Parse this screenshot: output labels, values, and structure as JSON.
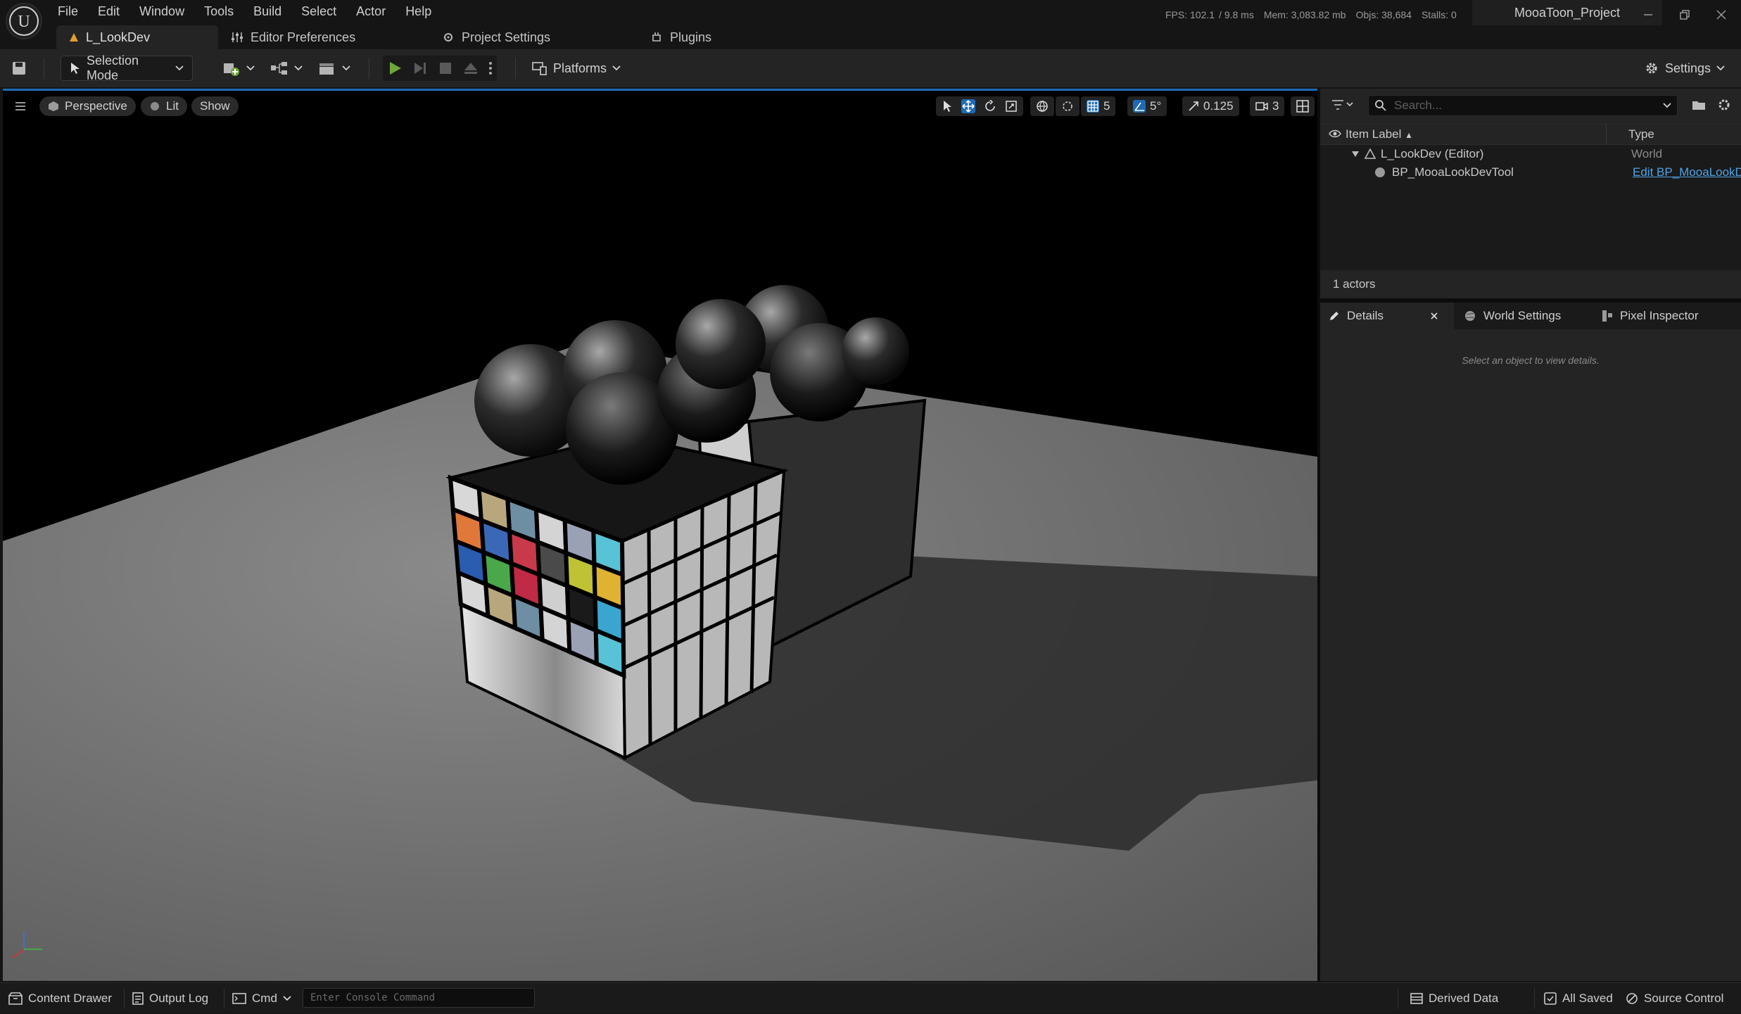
{
  "menu": [
    "File",
    "Edit",
    "Window",
    "Tools",
    "Build",
    "Select",
    "Actor",
    "Help"
  ],
  "stats": {
    "fps": "FPS: 102.1",
    "ms": "/ 9.8 ms",
    "mem": "Mem: 3,083.82 mb",
    "objs": "Objs: 38,684",
    "stalls": "Stalls: 0"
  },
  "project_name": "MooaToon_Project",
  "tabs": [
    "L_LookDev",
    "Editor Preferences",
    "Project Settings",
    "Plugins"
  ],
  "toolbar": {
    "selection_mode": "Selection Mode",
    "platforms": "Platforms",
    "settings": "Settings"
  },
  "viewport": {
    "perspective": "Perspective",
    "lit": "Lit",
    "show": "Show",
    "grid_snap": "5",
    "rotation_snap": "5°",
    "scale_snap": "0.125",
    "camera_speed": "3"
  },
  "outliner": {
    "search_placeholder": "Search...",
    "col_label": "Item Label",
    "col_type": "Type",
    "rows": [
      {
        "label": "L_LookDev (Editor)",
        "type": "World"
      },
      {
        "label": "BP_MooaLookDevTool",
        "type": "Edit BP_MooaLookDevTool"
      }
    ],
    "actors_count": "1 actors"
  },
  "details": {
    "tabs": [
      "Details",
      "World Settings",
      "Pixel Inspector"
    ],
    "empty_msg": "Select an object to view details."
  },
  "statusbar": {
    "content_drawer": "Content Drawer",
    "output_log": "Output Log",
    "cmd": "Cmd",
    "console_placeholder": "Enter Console Command",
    "derived_data": "Derived Data",
    "all_saved": "All Saved",
    "source_control": "Source Control"
  },
  "colors": {
    "accent": "#1d6bb6",
    "play_green": "#6ea83a",
    "chart_cells": [
      "#d8d8d8",
      "#b8a77c",
      "#6e8fa3",
      "#d4d4d4",
      "#9aa1b5",
      "#58c2d6",
      "#e0783a",
      "#3a68b6",
      "#c83a4a",
      "#4a4a4a",
      "#c0c236",
      "#e0b232",
      "#2a5cb0",
      "#4aa84a",
      "#c02a44",
      "#cfcfcf",
      "#1a1a1a",
      "#3aa6d0"
    ]
  }
}
